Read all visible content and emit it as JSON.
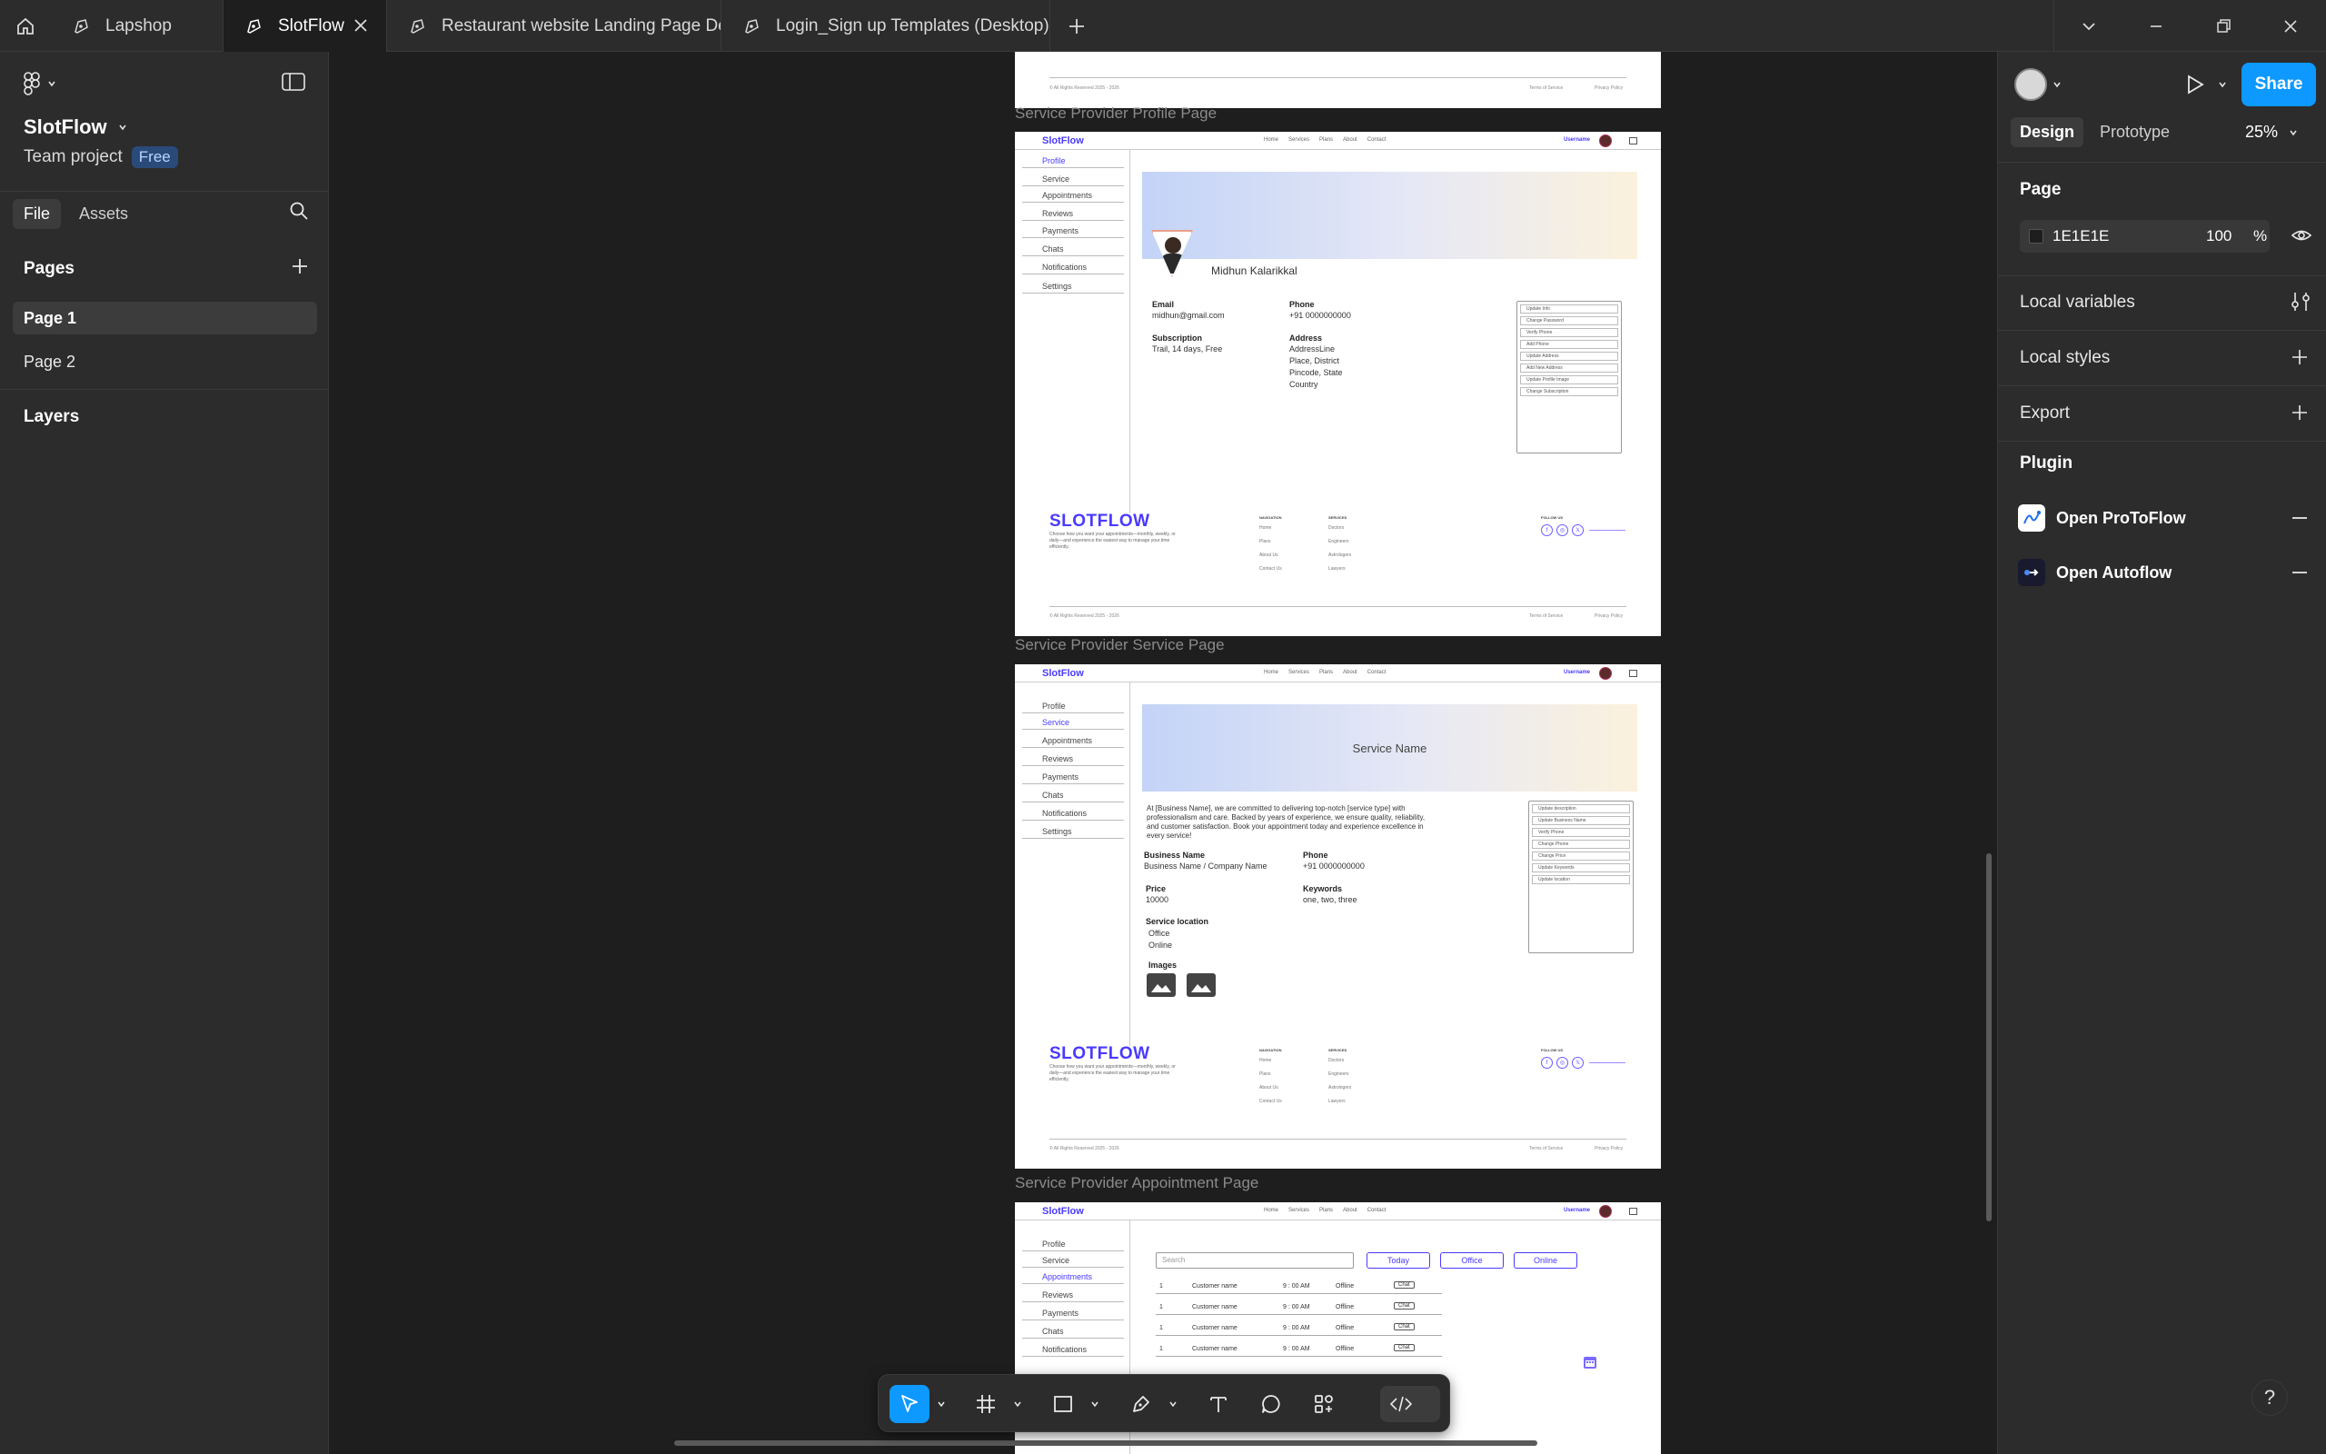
{
  "tabs": [
    {
      "label": "Lapshop"
    },
    {
      "label": "SlotFlow"
    },
    {
      "label": "Restaurant website Landing Page De"
    },
    {
      "label": "Login_Sign up Templates (Desktop) (("
    }
  ],
  "left_panel": {
    "file_name": "SlotFlow",
    "team_label": "Team project",
    "plan_badge": "Free",
    "file_tab": "File",
    "assets_tab": "Assets",
    "pages_heading": "Pages",
    "pages": [
      {
        "label": "Page 1"
      },
      {
        "label": "Page 2"
      }
    ],
    "layers_heading": "Layers"
  },
  "right_panel": {
    "share_label": "Share",
    "design_tab": "Design",
    "prototype_tab": "Prototype",
    "zoom": "25%",
    "page_heading": "Page",
    "page_color": "1E1E1E",
    "page_opacity": "100",
    "percent": "%",
    "local_variables": "Local variables",
    "local_styles": "Local styles",
    "export": "Export",
    "plugin_heading": "Plugin",
    "plugins": [
      {
        "label": "Open ProToFlow"
      },
      {
        "label": "Open Autoflow"
      }
    ]
  },
  "canvas": {
    "frames": [
      {
        "label": "Service Provider Profile Page"
      },
      {
        "label": "Service Provider Service Page"
      },
      {
        "label": "Service Provider Appointment Page"
      }
    ],
    "common": {
      "logo": "SlotFlow",
      "nav": [
        "Home",
        "Services",
        "Plans",
        "About",
        "Contact"
      ],
      "username": "Username",
      "sidebar": [
        "Profile",
        "Service",
        "Appointments",
        "Reviews",
        "Payments",
        "Chats",
        "Notifications",
        "Settings"
      ],
      "footer_logo": "SLOTFLOW",
      "footer_desc": "Choose how you want your appointments—monthly, weekly, or daily—and experience the easiest way to manage your time efficiently.",
      "footer_nav_heading": "NAVIGATION",
      "footer_nav": [
        "Home",
        "Plans",
        "About Us",
        "Contact Us"
      ],
      "footer_services_heading": "SERVICES",
      "footer_services": [
        "Doctors",
        "Engineers",
        "Astrologers",
        "Lawyers"
      ],
      "follow_us": "FOLLOW US",
      "copyright": "© All Rights Reserved 2025 - 2026",
      "terms": "Terms of Service",
      "privacy": "Privacy Policy"
    },
    "profile": {
      "name": "Midhun Kalarikkal",
      "email_label": "Email",
      "email": "midhun@gmail.com",
      "phone_label": "Phone",
      "phone": "+91 0000000000",
      "subscription_label": "Subscription",
      "subscription": "Trail, 14 days, Free",
      "address_label": "Address",
      "address_lines": [
        "AddressLine",
        "Place, District",
        "Pincode, State",
        "Country"
      ],
      "actions": [
        "Update Info",
        "Change Password",
        "Verify Phone",
        "Add Phone",
        "Update Address",
        "Add New Address",
        "Update Profile Image",
        "Change Subscription"
      ]
    },
    "service": {
      "banner_title": "Service Name",
      "description_lines": [
        "At [Business Name], we are committed to delivering top-notch [service type] with",
        "professionalism and care. Backed by years of experience, we ensure quality, reliability,",
        "and customer satisfaction. Book your appointment today and experience excellence in",
        "every service!"
      ],
      "business_name_label": "Business Name",
      "business_name": "Business Name / Company Name",
      "phone_label": "Phone",
      "phone": "+91 0000000000",
      "price_label": "Price",
      "price": "10000",
      "keywords_label": "Keywords",
      "keywords": "one, two, three",
      "location_label": "Service  location",
      "locations": [
        "Office",
        "Online"
      ],
      "images_label": "Images",
      "actions": [
        "Update description",
        "Update Business Name",
        "Verify Phone",
        "Change Phone",
        "Change Price",
        "Update Keywords",
        "Update location"
      ]
    },
    "appointments": {
      "search_placeholder": "Search",
      "filters": [
        "Today",
        "Office",
        "Online"
      ],
      "rows": [
        {
          "n": "1",
          "name": "Customer name",
          "time": "9 : 00 AM",
          "mode": "Offline",
          "action": "Chat"
        },
        {
          "n": "1",
          "name": "Customer name",
          "time": "9 : 00 AM",
          "mode": "Offline",
          "action": "Chat"
        },
        {
          "n": "1",
          "name": "Customer name",
          "time": "9 : 00 AM",
          "mode": "Offline",
          "action": "Chat"
        },
        {
          "n": "1",
          "name": "Customer name",
          "time": "9 : 00 AM",
          "mode": "Offline",
          "action": "Chat"
        }
      ]
    }
  },
  "toolbar": {
    "tools": [
      "move-tool",
      "frame-tool",
      "shape-tool",
      "pen-tool",
      "text-tool",
      "comment-tool",
      "actions-tool",
      "dev-mode-toggle"
    ]
  },
  "help_label": "?",
  "colors": {
    "accent": "#0d99ff",
    "brand": "#4a3aff",
    "panel": "#2c2c2c",
    "canvas": "#1e1e1e"
  }
}
